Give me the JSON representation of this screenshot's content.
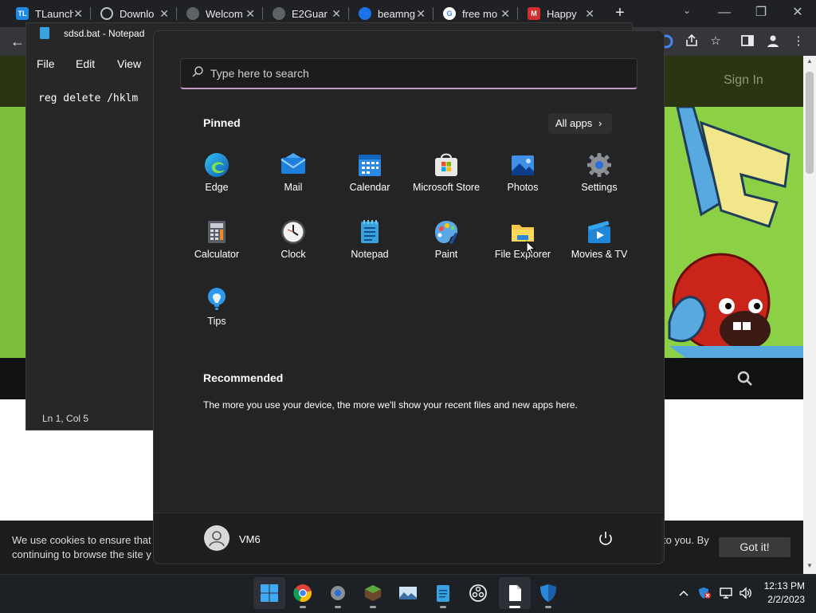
{
  "browser": {
    "tabs": [
      {
        "title": "TLaunch",
        "fav_text": "TL",
        "fav_color": "#1e88e5"
      },
      {
        "title": "Downlo",
        "fav_text": "",
        "fav_color": "#5f6368"
      },
      {
        "title": "Welcom",
        "fav_text": "",
        "fav_color": "#5f6368"
      },
      {
        "title": "E2Guar",
        "fav_text": "",
        "fav_color": "#5f6368"
      },
      {
        "title": "beamng",
        "fav_text": "",
        "fav_color": "#1a73e8"
      },
      {
        "title": "free mo",
        "fav_text": "G",
        "fav_color": "#ffffff"
      },
      {
        "title": "Happy",
        "fav_text": "M",
        "fav_color": "#d32f2f"
      }
    ],
    "new_tab_symbol": "+"
  },
  "website": {
    "sign_in": "Sign In",
    "cookie_line1": "We use cookies to ensure that",
    "cookie_line2": "continuing to browse the site y",
    "cookie_right": "to you. By",
    "got_it": "Got it!"
  },
  "notepad": {
    "title": "sdsd.bat - Notepad",
    "menu": [
      "File",
      "Edit",
      "View"
    ],
    "content": "reg delete /hklm",
    "status": "Ln 1, Col 5"
  },
  "start_menu": {
    "search_placeholder": "Type here to search",
    "pinned_heading": "Pinned",
    "all_apps": "All apps",
    "pinned": [
      {
        "label": "Edge",
        "icon": "edge-icon"
      },
      {
        "label": "Mail",
        "icon": "mail-icon"
      },
      {
        "label": "Calendar",
        "icon": "calendar-icon"
      },
      {
        "label": "Microsoft Store",
        "icon": "store-icon"
      },
      {
        "label": "Photos",
        "icon": "photos-icon"
      },
      {
        "label": "Settings",
        "icon": "settings-icon"
      },
      {
        "label": "Calculator",
        "icon": "calculator-icon"
      },
      {
        "label": "Clock",
        "icon": "clock-icon"
      },
      {
        "label": "Notepad",
        "icon": "notepad-icon"
      },
      {
        "label": "Paint",
        "icon": "paint-icon"
      },
      {
        "label": "File Explorer",
        "icon": "folder-icon"
      },
      {
        "label": "Movies & TV",
        "icon": "movies-icon"
      },
      {
        "label": "Tips",
        "icon": "tips-icon"
      }
    ],
    "recommended_heading": "Recommended",
    "recommended_text": "The more you use your device, the more we'll show your recent files and new apps here.",
    "user_name": "VM6"
  },
  "taskbar": {
    "time": "12:13 PM",
    "date": "2/2/2023"
  },
  "colors": {
    "accent": "#c49ac7",
    "start_bg": "#242424",
    "taskbar_bg": "#1d2126",
    "site_green": "#7cbf3f"
  }
}
